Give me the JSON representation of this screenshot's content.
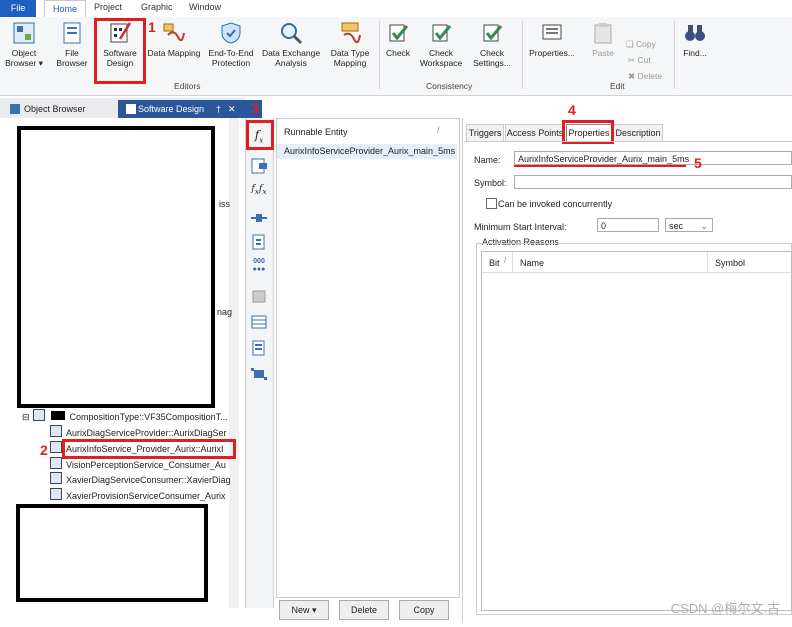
{
  "menu": {
    "file": "File",
    "home": "Home",
    "project": "Project",
    "graphic": "Graphic",
    "window": "Window"
  },
  "ribbon": {
    "object_browser": [
      "Object",
      "Browser ▾"
    ],
    "file_browser": [
      "File",
      "Browser"
    ],
    "software_design": [
      "Software",
      "Design"
    ],
    "data_mapping": "Data Mapping",
    "end_to_end": [
      "End-To-End",
      "Protection"
    ],
    "data_exchange": [
      "Data Exchange",
      "Analysis"
    ],
    "data_type_mapping": [
      "Data Type",
      "Mapping"
    ],
    "check": "Check",
    "check_workspace": [
      "Check",
      "Workspace"
    ],
    "check_settings": [
      "Check",
      "Settings..."
    ],
    "properties": "Properties...",
    "paste": "Paste",
    "copy": "Copy",
    "cut": "Cut",
    "delete": "Delete",
    "find": "Find...",
    "group_editors": "Editors",
    "group_consistency": "Consistency",
    "group_edit": "Edit"
  },
  "doc_tabs": {
    "object_browser": "Object Browser",
    "software_design": "Software Design",
    "pin": "†",
    "close": "✕"
  },
  "tree": {
    "composition": "CompositionType::VF35CompositionT...",
    "items": [
      "AurixDiagServiceProvider::AurixDiagSer",
      "AurixInfoService_Provider_Aurix::AurixI",
      "VisionPerceptionService_Consumer_Au",
      "XavierDiagServiceConsumer::XavierDiag",
      "XavierProvisionServiceConsumer_Aurix"
    ],
    "partial_1": "iss",
    "partial_2": "nag"
  },
  "runnables": {
    "header": "Runnable Entity",
    "sort_mark": "/",
    "items": [
      "AurixInfoServiceProvider_Aurix_main_5ms"
    ]
  },
  "bottom": {
    "new": "New",
    "delete": "Delete",
    "copy": "Copy"
  },
  "props": {
    "tabs": [
      "Triggers",
      "Access Points",
      "Properties",
      "Description"
    ],
    "name_label": "Name:",
    "name_value": "AurixInfoServiceProvider_Aurix_main_5ms",
    "symbol_label": "Symbol:",
    "symbol_value": "",
    "concurrent_label": "Can be invoked concurrently",
    "min_start_label": "Minimum Start Interval:",
    "min_start_value": "0",
    "unit_value": "sec",
    "activation_label": "Activation Reasons",
    "col_bit": "Bit",
    "col_bit_sort": "/",
    "col_name": "Name",
    "col_symbol": "Symbol"
  },
  "annotations": [
    "1",
    "2",
    "3",
    "4",
    "5"
  ],
  "watermark": "CSDN @梅尔文.古",
  "colors": {
    "accent": "#1f5fbf",
    "annotation_red": "#e02020"
  }
}
